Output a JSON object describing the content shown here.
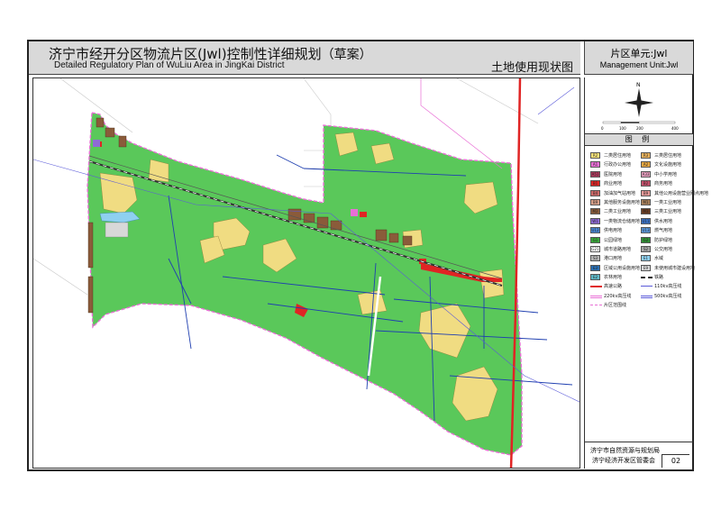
{
  "title": {
    "cn": "济宁市经开分区物流片区(Jwl)控制性详细规划",
    "draft": "（草案）",
    "en": "Detailed Regulatory Plan of WuLiu Area in JingKai District",
    "sub": "土地使用现状图"
  },
  "unit": {
    "cn": "片区单元:Jwl",
    "en": "Management Unit:Jwl"
  },
  "compass": {
    "north": "N",
    "scale_labels": [
      "0",
      "100",
      "200",
      "400"
    ]
  },
  "legend": {
    "title": "图 例",
    "items": [
      {
        "code": "R2",
        "label": "二类居住用地",
        "color": "#f5e17a"
      },
      {
        "code": "R3",
        "label": "三类居住用地",
        "color": "#e8b15c"
      },
      {
        "code": "A1",
        "label": "行政办公用地",
        "color": "#e96fd6"
      },
      {
        "code": "A2",
        "label": "文化设施用地",
        "color": "#e6a640"
      },
      {
        "code": "A51",
        "label": "医院用地",
        "color": "#b03a5e"
      },
      {
        "code": "A33",
        "label": "中小学用地",
        "color": "#e9a0c0"
      },
      {
        "code": "B1",
        "label": "商业用地",
        "color": "#e02424"
      },
      {
        "code": "B2",
        "label": "商务用地",
        "color": "#c44f6b"
      },
      {
        "code": "B4",
        "label": "加油加气站用地",
        "color": "#cf6a6a"
      },
      {
        "code": "B9",
        "label": "其他公用设施营业网点用地",
        "color": "#e89a9a"
      },
      {
        "code": "B9",
        "label": "其他服务设施用地",
        "color": "#d9a089"
      },
      {
        "code": "M1",
        "label": "一类工业用地",
        "color": "#a9805a"
      },
      {
        "code": "M2",
        "label": "二类工业用地",
        "color": "#8a5b3a"
      },
      {
        "code": "M3",
        "label": "三类工业用地",
        "color": "#6b3d22"
      },
      {
        "code": "W1",
        "label": "一类物流仓储用地",
        "color": "#8f6ad6"
      },
      {
        "code": "U11",
        "label": "供水用地",
        "color": "#3a73c9"
      },
      {
        "code": "U12",
        "label": "供电用地",
        "color": "#4a8ad9"
      },
      {
        "code": "U13",
        "label": "燃气用地",
        "color": "#5d9be0"
      },
      {
        "code": "G1",
        "label": "公园绿地",
        "color": "#39a83a"
      },
      {
        "code": "G2",
        "label": "防护绿地",
        "color": "#2f8f34"
      },
      {
        "code": "G21",
        "label": "城市道路用地",
        "color": "#ffffff"
      },
      {
        "code": "S2",
        "label": "公交用地",
        "color": "#a6a6a6"
      },
      {
        "code": "S3",
        "label": "港口用地",
        "color": "#b5b5b5"
      },
      {
        "code": "E1",
        "label": "水域",
        "color": "#8ed0f0"
      },
      {
        "code": "E3",
        "label": "区域公用设施用地",
        "color": "#2a6fb3"
      },
      {
        "code": "E9",
        "label": "未使用城市建设用地",
        "color": "#d8d8d8"
      },
      {
        "code": "E2",
        "label": "农林用地",
        "color": "#5fb9c8"
      },
      {
        "code": "",
        "label": "铁路",
        "color": "#222222",
        "line": "rail"
      },
      {
        "code": "",
        "label": "高速公路",
        "color": "#e02424",
        "line": "solid"
      },
      {
        "code": "",
        "label": "110kv高压线",
        "color": "#5a5ad9",
        "line": "thin"
      },
      {
        "code": "",
        "label": "220kv高压线",
        "color": "#e96fd6",
        "line": "double"
      },
      {
        "code": "",
        "label": "500kv高压线",
        "color": "#5a5ad9",
        "line": "double"
      },
      {
        "code": "",
        "label": "片区范围线",
        "color": "#e96fd6",
        "line": "dash"
      }
    ]
  },
  "footer": {
    "org1": "济宁市自然资源与规划局",
    "org2": "济宁经济开发区管委会",
    "page": "02"
  },
  "map": {
    "colors": {
      "green": "#5ac85a",
      "residential": "#f0dc82",
      "industrial": "#8a5b3a",
      "commercial": "#e02424",
      "water": "#8ed0f0",
      "road": "#1f3fb0",
      "boundary": "#e96fd6",
      "highway": "#e02424",
      "rail": "#333333"
    }
  }
}
